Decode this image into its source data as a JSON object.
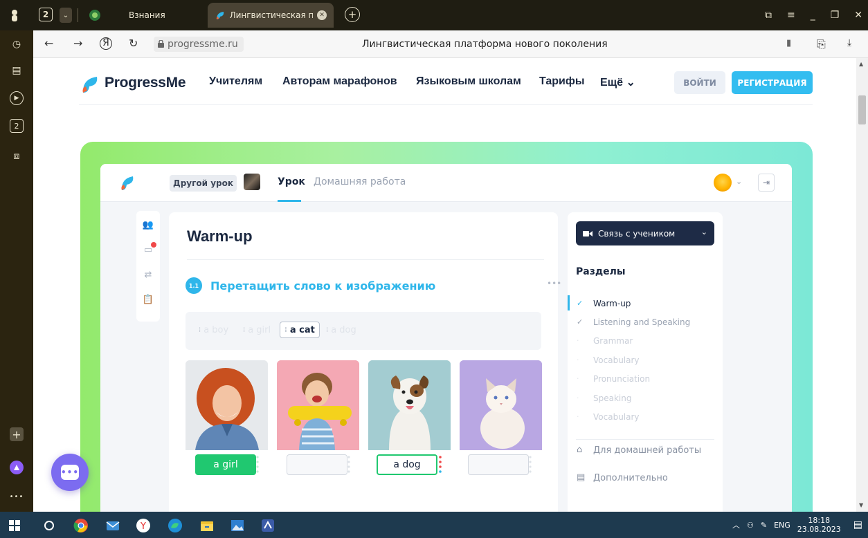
{
  "browser": {
    "tab_count": "2",
    "tabs": [
      {
        "label": "Взнания"
      },
      {
        "label": "Лингвистическая плато"
      }
    ],
    "url": "progressme.ru",
    "page_title": "Лингвистическая платформа нового поколения"
  },
  "site": {
    "brand": "ProgressMe",
    "nav": [
      "Учителям",
      "Авторам марафонов",
      "Языковым школам",
      "Тарифы",
      "Ещё ⌄"
    ],
    "login": "ВОЙТИ",
    "register": "РЕГИСТРАЦИЯ"
  },
  "lesson": {
    "other_lesson": "Другой урок",
    "tab_lesson": "Урок",
    "tab_homework": "Домашняя работа",
    "section_title": "Warm-up",
    "task_number": "1.1",
    "task_title": "Перетащить слово к изображению",
    "word_bank": [
      {
        "word": "a boy",
        "active": false
      },
      {
        "word": "a girl",
        "active": false
      },
      {
        "word": "a cat",
        "active": true
      },
      {
        "word": "a dog",
        "active": false
      }
    ],
    "photos": [
      {
        "subject": "girl-photo",
        "answer": "a girl",
        "state": "filled"
      },
      {
        "subject": "boy-photo",
        "answer": "",
        "state": "empty"
      },
      {
        "subject": "dog-photo",
        "answer": "a dog",
        "state": "selected"
      },
      {
        "subject": "cat-photo",
        "answer": "",
        "state": "empty"
      }
    ]
  },
  "panel": {
    "connect": "Связь с учеником",
    "sections_title": "Разделы",
    "sections": [
      {
        "label": "Warm-up",
        "state": "current"
      },
      {
        "label": "Listening and Speaking",
        "state": "done"
      },
      {
        "label": "Grammar",
        "state": "todo"
      },
      {
        "label": "Vocabulary",
        "state": "todo"
      },
      {
        "label": "Pronunciation",
        "state": "todo"
      },
      {
        "label": "Speaking",
        "state": "todo"
      },
      {
        "label": "Vocabulary",
        "state": "todo"
      }
    ],
    "homework": "Для домашней работы",
    "extra": "Дополнительно"
  },
  "taskbar": {
    "lang": "ENG",
    "time": "18:18",
    "date": "23.08.2023"
  },
  "colors": {
    "accent": "#2fb6ea",
    "success": "#20c870",
    "dark": "#1b2840"
  }
}
